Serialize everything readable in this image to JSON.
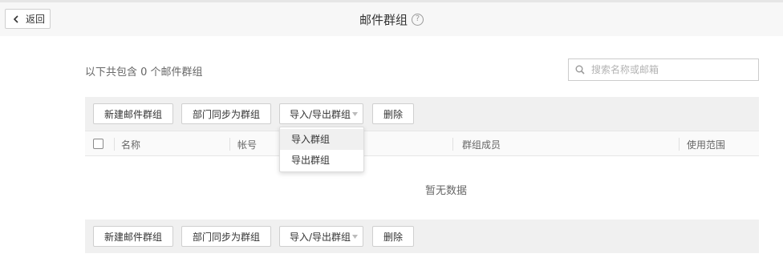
{
  "header": {
    "back_label": "返回",
    "title": "邮件群组",
    "help_glyph": "?"
  },
  "summary": "以下共包含 0 个邮件群组",
  "search": {
    "placeholder": "搜索名称或邮箱"
  },
  "toolbar": {
    "new_label": "新建邮件群组",
    "sync_label": "部门同步为群组",
    "io_label": "导入/导出群组",
    "delete_label": "删除"
  },
  "table": {
    "columns": [
      "名称",
      "帐号",
      "群组成员",
      "使用范围"
    ],
    "empty_text": "暂无数据"
  },
  "dropdown": {
    "items": [
      "导入群组",
      "导出群组"
    ]
  },
  "colors": {
    "toolbar_bg": "#f0f0f0",
    "header_bg": "#f7f7f7",
    "border": "#cfcfcf"
  }
}
